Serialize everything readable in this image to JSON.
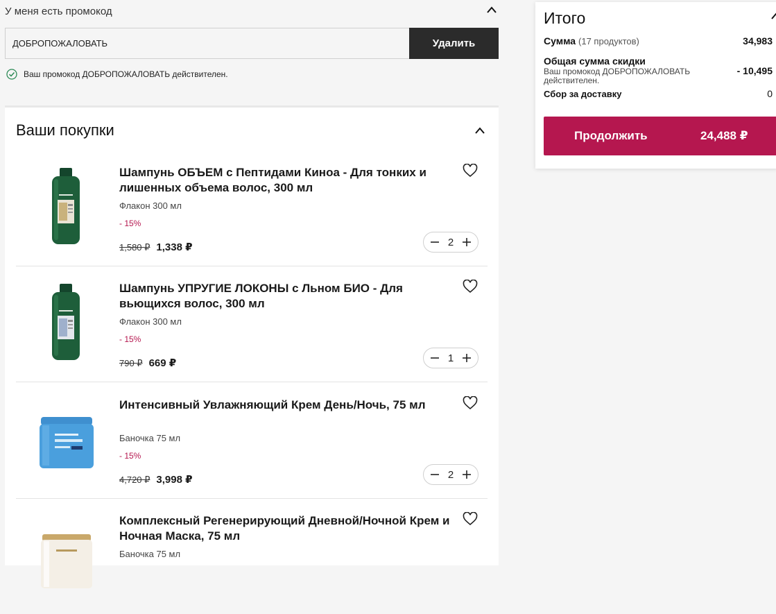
{
  "promo": {
    "title": "У меня есть промокод",
    "code_value": "ДОБРОПОЖАЛОВАТЬ",
    "remove_label": "Удалить",
    "status_text": "Ваш промокод ДОБРОПОЖАЛОВАТЬ действителен.",
    "status_color": "#2e8b57"
  },
  "cart": {
    "title": "Ваши покупки",
    "items": [
      {
        "name": "Шампунь ОБЪЕМ с Пептидами Киноа - Для тонких и лишенных объема волос, 300 мл",
        "variant": "Флакон 300 мл",
        "discount": "- 15%",
        "old_price": "1,580 ₽",
        "new_price": "1,338 ₽",
        "quantity": "2",
        "image": "green-shampoo-bottle"
      },
      {
        "name": "Шампунь УПРУГИЕ ЛОКОНЫ с Льном БИО - Для вьющихся волос, 300 мл",
        "variant": "Флакон 300 мл",
        "discount": "- 15%",
        "old_price": "790 ₽",
        "new_price": "669 ₽",
        "quantity": "1",
        "image": "green-shampoo-bottle"
      },
      {
        "name": "Интенсивный Увлажняющий Крем День/Ночь, 75 мл",
        "variant": "Баночка 75 мл",
        "discount": "- 15%",
        "old_price": "4,720 ₽",
        "new_price": "3,998 ₽",
        "quantity": "2",
        "image": "blue-cream-jar"
      },
      {
        "name": "Комплексный Регенерирующий Дневной/Ночной Крем и Ночная Маска, 75 мл",
        "variant": "Баночка 75 мл",
        "image": "gold-cream-jar"
      }
    ]
  },
  "summary": {
    "title": "Итого",
    "sum_label": "Сумма",
    "sum_count": "(17 продуктов)",
    "sum_value": "34,983",
    "discount_label": "Общая сумма скидки",
    "discount_note": "Ваш промокод ДОБРОПОЖАЛОВАТЬ действителен.",
    "discount_value": "- 10,495",
    "delivery_label": "Сбор за доставку",
    "delivery_value": "0",
    "continue_label": "Продолжить",
    "total": "24,488 ₽"
  },
  "colors": {
    "accent": "#b5174f",
    "dark_button": "#2b2b2b",
    "background": "#f5f5f5"
  }
}
